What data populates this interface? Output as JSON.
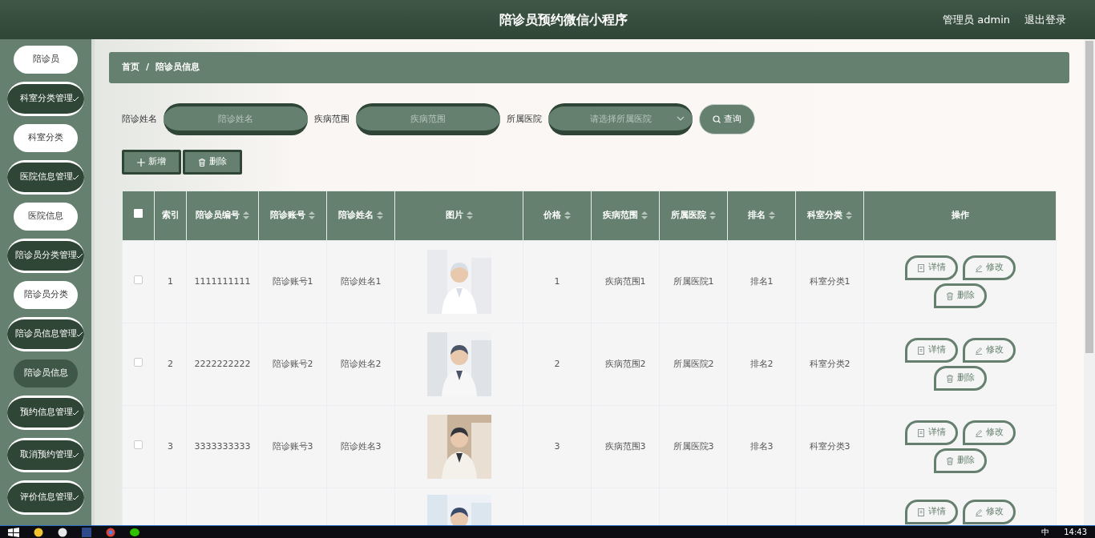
{
  "header": {
    "title": "陪诊员预约微信小程序",
    "user": "管理员 admin",
    "logout": "退出登录"
  },
  "sidebar": {
    "items": [
      {
        "kind": "top",
        "label": "陪诊员",
        "selected": false
      },
      {
        "kind": "group",
        "label": "科室分类管理"
      },
      {
        "kind": "sub",
        "label": "科室分类",
        "selected": false
      },
      {
        "kind": "group",
        "label": "医院信息管理"
      },
      {
        "kind": "sub",
        "label": "医院信息",
        "selected": false
      },
      {
        "kind": "group",
        "label": "陪诊员分类管理"
      },
      {
        "kind": "sub",
        "label": "陪诊员分类",
        "selected": false
      },
      {
        "kind": "group",
        "label": "陪诊员信息管理"
      },
      {
        "kind": "sub",
        "label": "陪诊员信息",
        "selected": true
      },
      {
        "kind": "group",
        "label": "预约信息管理"
      },
      {
        "kind": "group",
        "label": "取消预约管理"
      },
      {
        "kind": "group",
        "label": "评价信息管理"
      }
    ]
  },
  "breadcrumb": {
    "items": [
      "首页",
      "陪诊员信息"
    ],
    "separator": "/"
  },
  "filters": [
    {
      "kind": "input",
      "label": "陪诊姓名",
      "placeholder": "陪诊姓名"
    },
    {
      "kind": "input",
      "label": "疾病范围",
      "placeholder": "疾病范围"
    },
    {
      "kind": "select",
      "label": "所属医院",
      "placeholder": "请选择所属医院"
    }
  ],
  "search_button": "查询",
  "actions": [
    {
      "kind": "add",
      "label": "新增"
    },
    {
      "kind": "delete",
      "label": "删除"
    }
  ],
  "table": {
    "columns": [
      {
        "kind": "checkbox",
        "checked": false
      },
      {
        "label": "索引",
        "sortable": false
      },
      {
        "label": "陪诊员编号",
        "sortable": true
      },
      {
        "label": "陪诊账号",
        "sortable": true
      },
      {
        "label": "陪诊姓名",
        "sortable": true
      },
      {
        "label": "图片",
        "sortable": true
      },
      {
        "label": "价格",
        "sortable": true
      },
      {
        "label": "疾病范围",
        "sortable": true
      },
      {
        "label": "所属医院",
        "sortable": true
      },
      {
        "label": "排名",
        "sortable": true
      },
      {
        "label": "科室分类",
        "sortable": true
      },
      {
        "label": "操作",
        "sortable": false
      }
    ],
    "rows": [
      {
        "cells": [
          {
            "kind": "checkbox",
            "checked": false
          },
          "1",
          "1111111111",
          "陪诊账号1",
          "陪诊姓名1",
          {
            "kind": "picture"
          },
          "1",
          "疾病范围1",
          "所属医院1",
          "排名1",
          "科室分类1",
          {
            "kind": "actions",
            "buttons": [
              {
                "kind": "detail",
                "label": "详情"
              },
              {
                "kind": "edit",
                "label": "修改"
              },
              {
                "kind": "delete",
                "label": "删除"
              }
            ]
          }
        ]
      },
      {
        "cells": [
          {
            "kind": "checkbox",
            "checked": false
          },
          "2",
          "2222222222",
          "陪诊账号2",
          "陪诊姓名2",
          {
            "kind": "picture"
          },
          "2",
          "疾病范围2",
          "所属医院2",
          "排名2",
          "科室分类2",
          {
            "kind": "actions",
            "buttons": [
              {
                "kind": "detail",
                "label": "详情"
              },
              {
                "kind": "edit",
                "label": "修改"
              },
              {
                "kind": "delete",
                "label": "删除"
              }
            ]
          }
        ]
      },
      {
        "cells": [
          {
            "kind": "checkbox",
            "checked": false
          },
          "3",
          "3333333333",
          "陪诊账号3",
          "陪诊姓名3",
          {
            "kind": "picture"
          },
          "3",
          "疾病范围3",
          "所属医院3",
          "排名3",
          "科室分类3",
          {
            "kind": "actions",
            "buttons": [
              {
                "kind": "detail",
                "label": "详情"
              },
              {
                "kind": "edit",
                "label": "修改"
              },
              {
                "kind": "delete",
                "label": "删除"
              }
            ]
          }
        ]
      },
      {
        "cells": [
          {
            "kind": "blank"
          },
          {
            "kind": "blank"
          },
          {
            "kind": "blank"
          },
          {
            "kind": "blank"
          },
          {
            "kind": "blank"
          },
          {
            "kind": "picture"
          },
          {
            "kind": "blank"
          },
          {
            "kind": "blank"
          },
          {
            "kind": "blank"
          },
          {
            "kind": "blank"
          },
          {
            "kind": "blank"
          },
          {
            "kind": "actions",
            "buttons": [
              {
                "kind": "detail",
                "label": "详情"
              },
              {
                "kind": "edit",
                "label": "修改"
              }
            ]
          }
        ]
      }
    ]
  },
  "taskbar": {
    "ime": "中",
    "time": "14:43"
  }
}
